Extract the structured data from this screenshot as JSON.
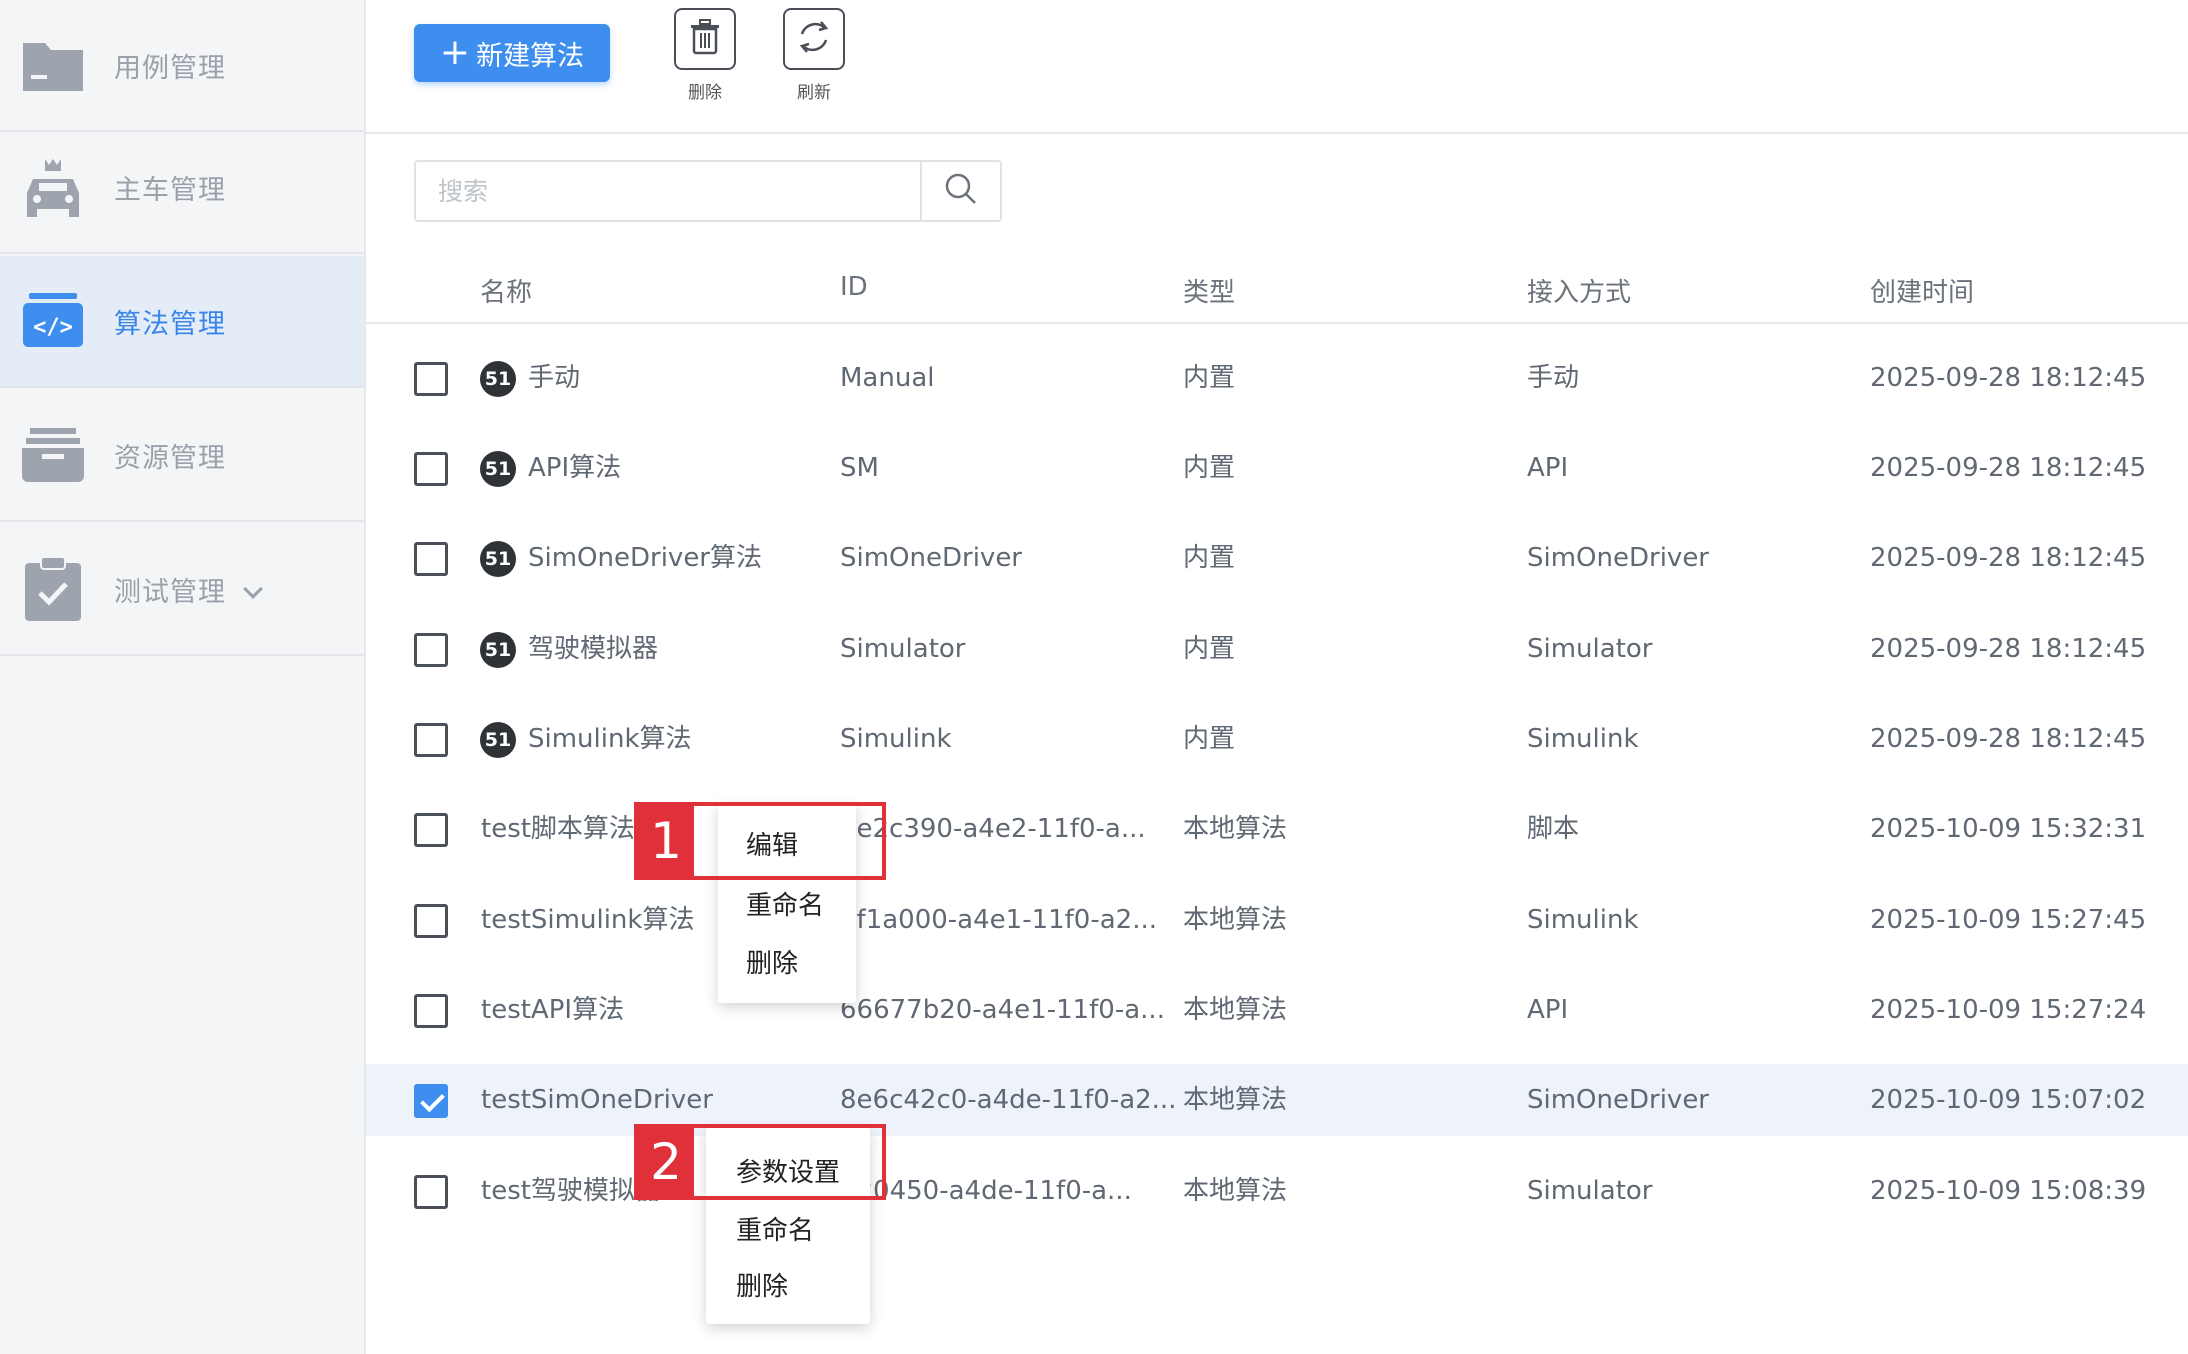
{
  "sidebar": {
    "items": [
      {
        "label": "用例管理",
        "icon": "folder-icon",
        "active": false
      },
      {
        "label": "主车管理",
        "icon": "car-icon",
        "active": false
      },
      {
        "label": "算法管理",
        "icon": "code-icon",
        "active": true
      },
      {
        "label": "资源管理",
        "icon": "archive-icon",
        "active": false
      },
      {
        "label": "测试管理",
        "icon": "clipboard-check-icon",
        "active": false
      }
    ]
  },
  "toolbar": {
    "new_label": "新建算法",
    "delete_label": "删除",
    "refresh_label": "刷新"
  },
  "search": {
    "placeholder": "搜索"
  },
  "table": {
    "headers": [
      "名称",
      "ID",
      "类型",
      "接入方式",
      "创建时间"
    ],
    "rows": [
      {
        "name": "手动",
        "id": "Manual",
        "type": "内置",
        "access": "手动",
        "created": "2025-09-28 18:12:45",
        "badge": "51",
        "checked": false
      },
      {
        "name": "API算法",
        "id": "SM",
        "type": "内置",
        "access": "API",
        "created": "2025-09-28 18:12:45",
        "badge": "51",
        "checked": false
      },
      {
        "name": "SimOneDriver算法",
        "id": "SimOneDriver",
        "type": "内置",
        "access": "SimOneDriver",
        "created": "2025-09-28 18:12:45",
        "badge": "51",
        "checked": false
      },
      {
        "name": "驾驶模拟器",
        "id": "Simulator",
        "type": "内置",
        "access": "Simulator",
        "created": "2025-09-28 18:12:45",
        "badge": "51",
        "checked": false
      },
      {
        "name": "Simulink算法",
        "id": "Simulink",
        "type": "内置",
        "access": "Simulink",
        "created": "2025-09-28 18:12:45",
        "badge": "51",
        "checked": false
      },
      {
        "name": "test脚本算法",
        "id": "de2c390-a4e2-11f0-a...",
        "type": "本地算法",
        "access": "脚本",
        "created": "2025-10-09 15:32:31",
        "badge": "",
        "checked": false
      },
      {
        "name": "testSimulink算法",
        "id": "2f1a000-a4e1-11f0-a2...",
        "type": "本地算法",
        "access": "Simulink",
        "created": "2025-10-09 15:27:45",
        "badge": "",
        "checked": false
      },
      {
        "name": "testAPI算法",
        "id": "66677b20-a4e1-11f0-a...",
        "type": "本地算法",
        "access": "API",
        "created": "2025-10-09 15:27:24",
        "badge": "",
        "checked": false
      },
      {
        "name": "testSimOneDriver",
        "id": "8e6c42c0-a4de-11f0-a2...",
        "type": "本地算法",
        "access": "SimOneDriver",
        "created": "2025-10-09 15:07:02",
        "badge": "",
        "checked": true
      },
      {
        "name": "test驾驶模拟器",
        "id": "d20450-a4de-11f0-a...",
        "type": "本地算法",
        "access": "Simulator",
        "created": "2025-10-09 15:08:39",
        "badge": "",
        "checked": false
      }
    ]
  },
  "context_menu_1": {
    "callout": "1",
    "items": [
      "编辑",
      "重命名",
      "删除"
    ]
  },
  "context_menu_2": {
    "callout": "2",
    "items": [
      "参数设置",
      "重命名",
      "删除"
    ]
  },
  "colors": {
    "accent": "#3e8ef0",
    "callout": "#e0303a",
    "sidebar_bg": "#f4f5f7",
    "active_bg": "#e4ecf8"
  }
}
